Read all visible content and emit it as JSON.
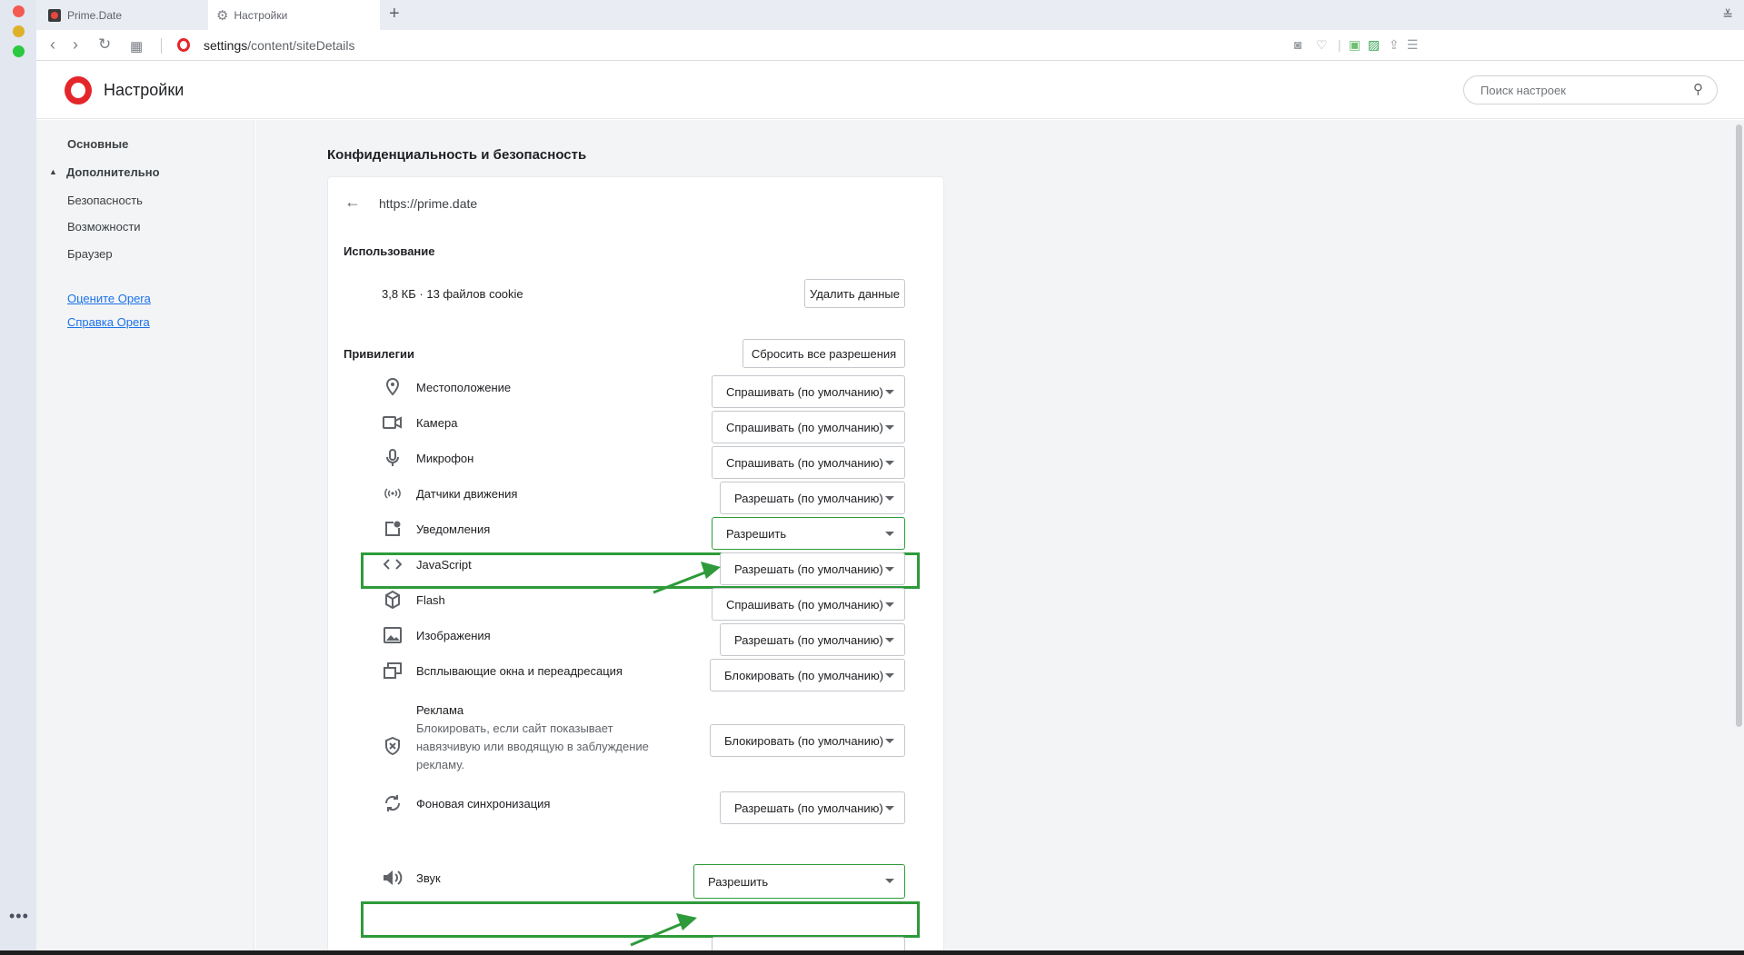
{
  "browser": {
    "tabs": [
      {
        "label": "Prime.Date"
      },
      {
        "label": "Настройки"
      }
    ],
    "new_tab": "+",
    "url_prefix": "settings",
    "url_path": "/content/siteDetails"
  },
  "header": {
    "title": "Настройки",
    "search_placeholder": "Поиск настроек"
  },
  "sidebar": {
    "items": [
      "Основные",
      "Дополнительно",
      "Безопасность",
      "Возможности",
      "Браузер"
    ],
    "links": [
      "Оцените Opera",
      "Справка Opera"
    ]
  },
  "main": {
    "section_title": "Конфиденциальность и безопасность",
    "origin": "https://prime.date",
    "usage": {
      "title": "Использование",
      "text": "3,8 КБ · 13 файлов cookie",
      "button": "Удалить данные"
    },
    "privileges": {
      "title": "Привилегии",
      "reset_button": "Сбросить все разрешения",
      "rows": [
        {
          "label": "Местоположение",
          "value": "Спрашивать (по умолчанию)",
          "icon": "location-pin-icon"
        },
        {
          "label": "Камера",
          "value": "Спрашивать (по умолчанию)",
          "icon": "camera-icon"
        },
        {
          "label": "Микрофон",
          "value": "Спрашивать (по умолчанию)",
          "icon": "microphone-icon"
        },
        {
          "label": "Датчики движения",
          "value": "Разрешать (по умолчанию)",
          "icon": "motion-sensor-icon"
        },
        {
          "label": "Уведомления",
          "value": "Разрешить",
          "icon": "notification-icon"
        },
        {
          "label": "JavaScript",
          "value": "Разрешать (по умолчанию)",
          "icon": "code-icon"
        },
        {
          "label": "Flash",
          "value": "Спрашивать (по умолчанию)",
          "icon": "cube-icon"
        },
        {
          "label": "Изображения",
          "value": "Разрешать (по умолчанию)",
          "icon": "image-icon"
        },
        {
          "label": "Всплывающие окна и переадресация",
          "value": "Блокировать (по умолчанию)",
          "icon": "popup-icon"
        },
        {
          "label": "Реклама",
          "description": "Блокировать, если сайт показывает навязчивую или вводящую в заблуждение рекламу.",
          "value": "Блокировать (по умолчанию)",
          "icon": "ad-block-icon"
        },
        {
          "label": "Фоновая синхронизация",
          "value": "Разрешать (по умолчанию)",
          "icon": "sync-icon"
        },
        {
          "label": "Звук",
          "value": "Разрешить",
          "icon": "speaker-icon"
        }
      ]
    }
  },
  "colors": {
    "highlight": "#2e9a3a",
    "opera_red": "#e4262a",
    "link": "#1a73e8"
  }
}
